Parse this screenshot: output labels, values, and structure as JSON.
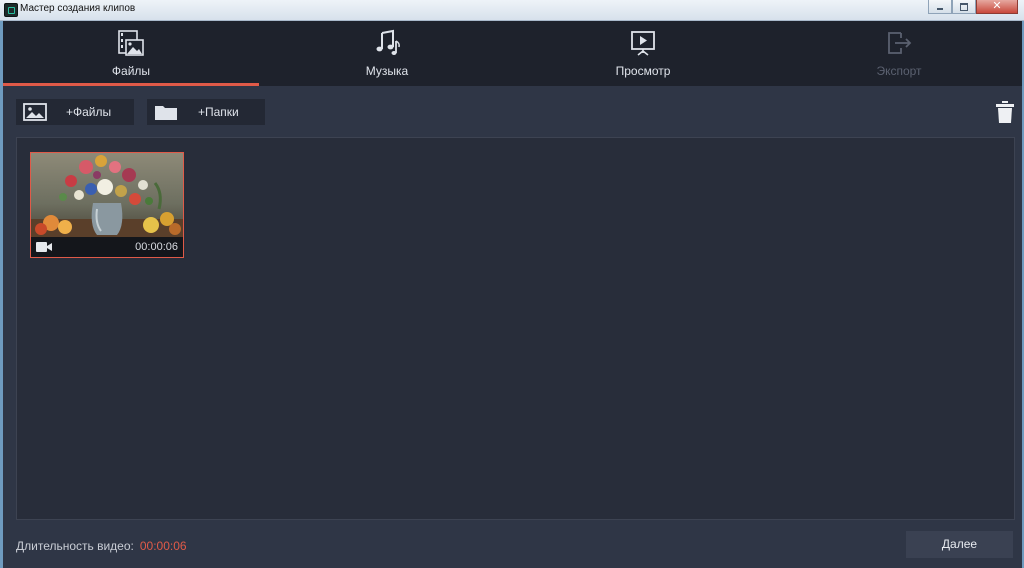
{
  "window": {
    "title": "Мастер создания клипов"
  },
  "tabs": [
    {
      "label": "Файлы",
      "icon": "film-image-icon",
      "state": "active"
    },
    {
      "label": "Музыка",
      "icon": "music-notes-icon",
      "state": "normal"
    },
    {
      "label": "Просмотр",
      "icon": "presentation-play-icon",
      "state": "normal"
    },
    {
      "label": "Экспорт",
      "icon": "export-icon",
      "state": "disabled"
    }
  ],
  "toolbar": {
    "add_files_label": "+Файлы",
    "add_folders_label": "+Папки"
  },
  "clips": [
    {
      "duration": "00:00:06",
      "type_icon": "video-camera-icon"
    }
  ],
  "footer": {
    "duration_label": "Длительность видео:",
    "duration_value": "00:00:06",
    "next_label": "Далее"
  },
  "colors": {
    "accent": "#e05a48",
    "tabbar_bg": "#1e222c",
    "app_bg": "#2f3646",
    "panel_bg": "#282d3a"
  }
}
